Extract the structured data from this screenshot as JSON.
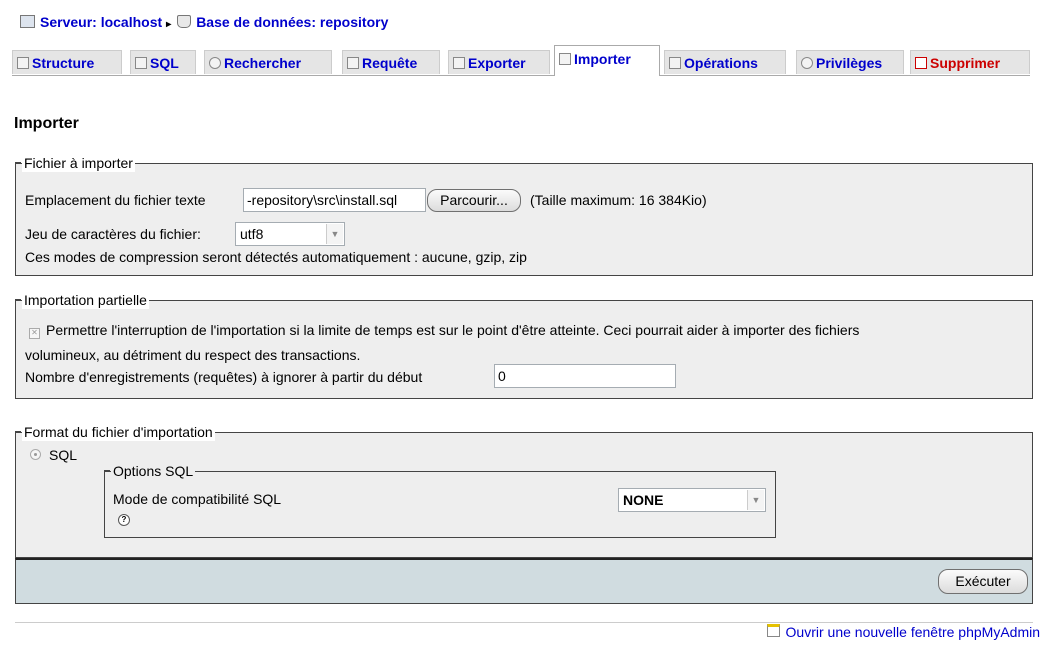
{
  "breadcrumb": {
    "server_label": "Serveur: localhost",
    "separator": "▸",
    "database_label": "Base de données: repository"
  },
  "tabs": [
    {
      "label": "Structure",
      "icon": "structure-icon"
    },
    {
      "label": "SQL",
      "icon": "sql-icon"
    },
    {
      "label": "Rechercher",
      "icon": "search-icon"
    },
    {
      "label": "Requête",
      "icon": "query-icon"
    },
    {
      "label": "Exporter",
      "icon": "export-icon"
    },
    {
      "label": "Importer",
      "icon": "import-icon",
      "active": true
    },
    {
      "label": "Opérations",
      "icon": "operations-icon"
    },
    {
      "label": "Privilèges",
      "icon": "privileges-icon"
    },
    {
      "label": "Supprimer",
      "icon": "delete-icon",
      "color": "#cc0000"
    }
  ],
  "page_title": "Importer",
  "file_section": {
    "legend": "Fichier à importer",
    "location_label": "Emplacement du fichier texte",
    "file_value": "-repository\\src\\install.sql",
    "browse_label": "Parcourir...",
    "max_size": "(Taille maximum: 16 384Kio)",
    "charset_label": "Jeu de caractères du fichier:",
    "charset_value": "utf8",
    "compression_note": "Ces modes de compression seront détectés automatiquement : aucune, gzip, zip"
  },
  "partial_section": {
    "legend": "Importation partielle",
    "interrupt_label_1": "Permettre l'interruption de l'importation si la limite de temps est sur le point d'être atteinte. Ceci pourrait aider à importer des fichiers",
    "interrupt_label_2": "volumineux, au détriment du respect des transactions.",
    "skip_label": "Nombre d'enregistrements (requêtes) à ignorer à partir du début",
    "skip_value": "0"
  },
  "format_section": {
    "legend": "Format du fichier d'importation",
    "format_sql_label": "SQL",
    "options_legend": "Options SQL",
    "compat_label": "Mode de compatibilité SQL",
    "compat_value": "NONE"
  },
  "execute_label": "Exécuter",
  "new_window_link": "Ouvrir une nouvelle fenêtre phpMyAdmin",
  "colors": {
    "link": "#0000cc",
    "danger": "#cc0000",
    "panel_bg": "#eeeeee",
    "footer_bg": "#d0dce0"
  }
}
